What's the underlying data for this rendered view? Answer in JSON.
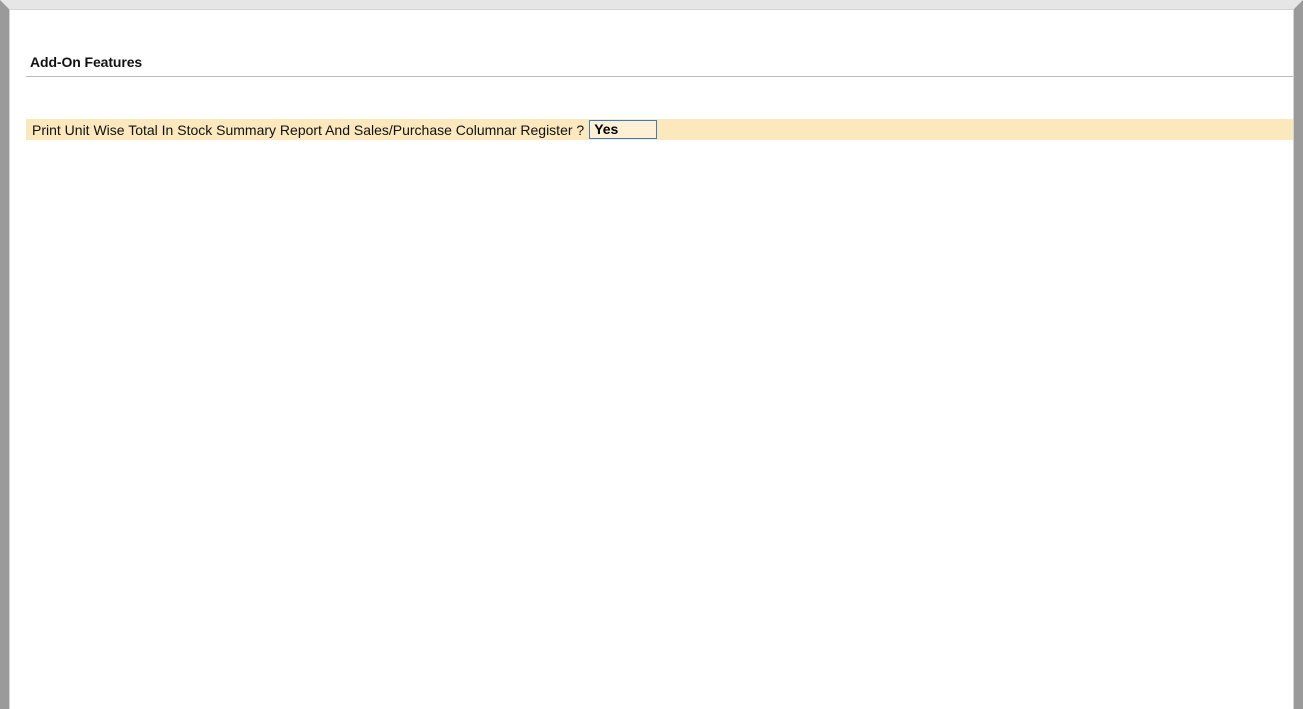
{
  "section": {
    "title": "Add-On Features"
  },
  "options": [
    {
      "label": "Print Unit Wise Total In Stock Summary Report And Sales/Purchase Columnar Register ?",
      "value": "Yes"
    }
  ],
  "colors": {
    "row_highlight": "#fbe8bd",
    "field_border": "#3a7cc2",
    "window_frame": "#9a9a9a"
  }
}
